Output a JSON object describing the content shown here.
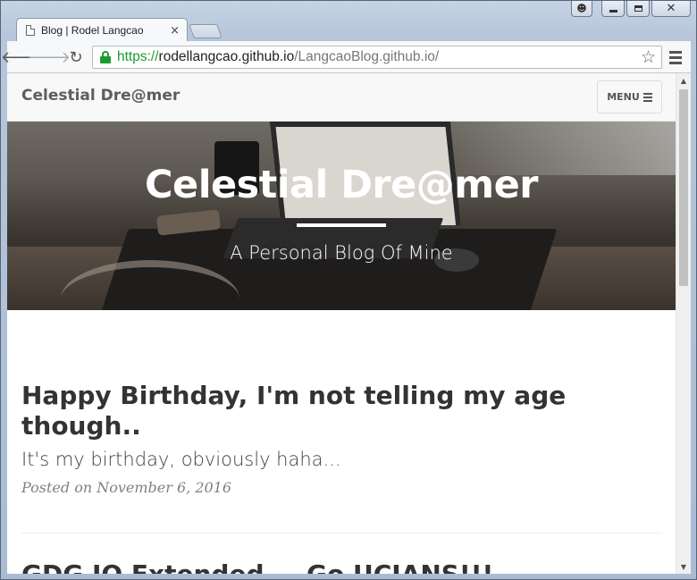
{
  "browser": {
    "tab_title": "Blog | Rodel Langcao",
    "tab_close": "×",
    "url_scheme": "https://",
    "url_host": "rodellangcao.github.io",
    "url_path": "/LangcaoBlog.github.io/",
    "icons": {
      "back": "arrow-left-icon",
      "forward": "arrow-right-icon",
      "reload": "reload-icon",
      "lock": "lock-icon",
      "bookmark": "star-icon",
      "menu": "hamburger-icon"
    }
  },
  "site": {
    "brand": "Celestial Dre@mer",
    "menu_label": "MENU",
    "hero_title": "Celestial Dre@mer",
    "hero_subtitle": "A Personal Blog Of Mine"
  },
  "posts": [
    {
      "title": "Happy Birthday, I'm not telling my age though..",
      "subtitle": "It's my birthday, obviously haha...",
      "meta": "Posted on November 6, 2016"
    },
    {
      "title": "GDG IO Extended — Go UCIANS!!!"
    }
  ],
  "colors": {
    "url_secure": "#1e9a32",
    "post_title": "#333333",
    "post_meta": "#808080",
    "navbar_bg": "#f8f8f8"
  }
}
